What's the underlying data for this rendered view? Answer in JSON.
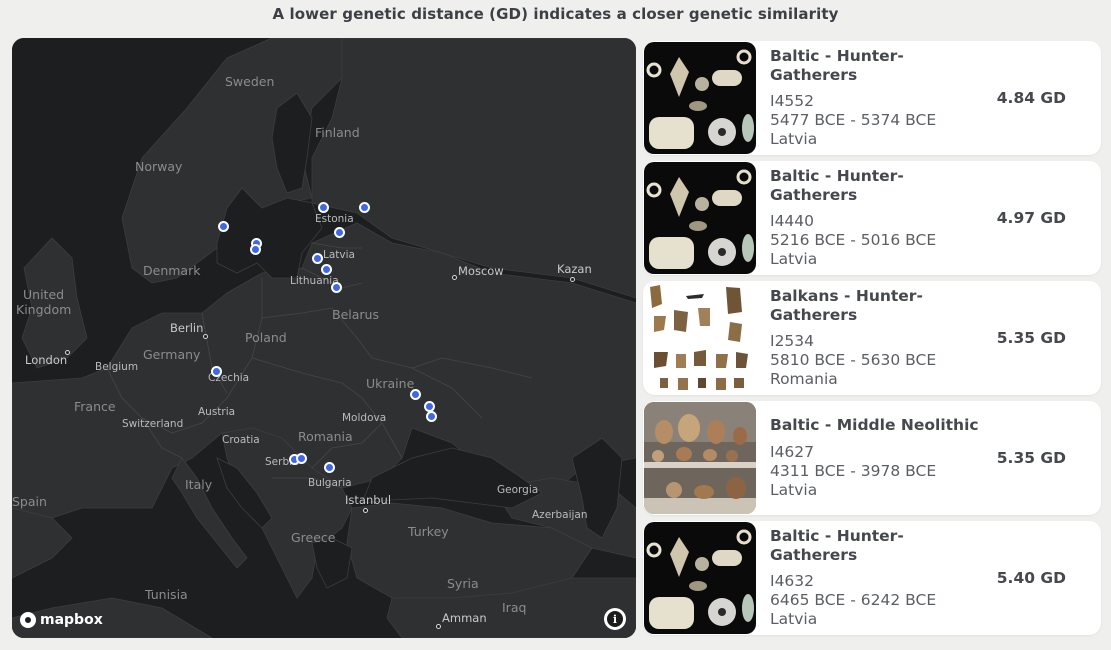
{
  "header": {
    "title": "A lower genetic distance (GD) indicates a closer genetic similarity"
  },
  "map": {
    "countries": [
      {
        "name": "Sweden"
      },
      {
        "name": "Finland"
      },
      {
        "name": "Norway"
      },
      {
        "name": "Estonia"
      },
      {
        "name": "Latvia"
      },
      {
        "name": "Lithuania"
      },
      {
        "name": "Denmark"
      },
      {
        "name": "United"
      },
      {
        "name": "Kingdom"
      },
      {
        "name": "Belarus"
      },
      {
        "name": "Poland"
      },
      {
        "name": "Germany"
      },
      {
        "name": "Belgium"
      },
      {
        "name": "Czechia"
      },
      {
        "name": "Ukraine"
      },
      {
        "name": "France"
      },
      {
        "name": "Austria"
      },
      {
        "name": "Switzerland"
      },
      {
        "name": "Moldova"
      },
      {
        "name": "Croatia"
      },
      {
        "name": "Romania"
      },
      {
        "name": "Serbia"
      },
      {
        "name": "Italy"
      },
      {
        "name": "Bulgaria"
      },
      {
        "name": "Georgia"
      },
      {
        "name": "Azerbaijan"
      },
      {
        "name": "Spain"
      },
      {
        "name": "Turkey"
      },
      {
        "name": "Greece"
      },
      {
        "name": "Syria"
      },
      {
        "name": "Tunisia"
      },
      {
        "name": "Iraq"
      }
    ],
    "cities": [
      {
        "name": "Moscow"
      },
      {
        "name": "Kazan"
      },
      {
        "name": "Berlin"
      },
      {
        "name": "London"
      },
      {
        "name": "Istanbul"
      },
      {
        "name": "Amman"
      }
    ],
    "attribution": "mapbox",
    "info_symbol": "i"
  },
  "results": [
    {
      "title": "Baltic - Hunter-Gatherers",
      "id": "I4552",
      "dates": "5477 BCE - 5374 BCE",
      "country": "Latvia",
      "gd": "4.84 GD",
      "thumbnail": "artifacts-beads-icon"
    },
    {
      "title": "Baltic - Hunter-Gatherers",
      "id": "I4440",
      "dates": "5216 BCE - 5016 BCE",
      "country": "Latvia",
      "gd": "4.97 GD",
      "thumbnail": "artifacts-beads-icon"
    },
    {
      "title": "Balkans - Hunter-Gatherers",
      "id": "I2534",
      "dates": "5810 BCE - 5630 BCE",
      "country": "Romania",
      "gd": "5.35 GD",
      "thumbnail": "stone-tools-icon"
    },
    {
      "title": "Baltic - Middle Neolithic",
      "id": "I4627",
      "dates": "4311 BCE - 3978 BCE",
      "country": "Latvia",
      "gd": "5.35 GD",
      "thumbnail": "pottery-display-icon"
    },
    {
      "title": "Baltic - Hunter-Gatherers",
      "id": "I4632",
      "dates": "6465 BCE - 6242 BCE",
      "country": "Latvia",
      "gd": "5.40 GD",
      "thumbnail": "artifacts-beads-icon"
    }
  ]
}
